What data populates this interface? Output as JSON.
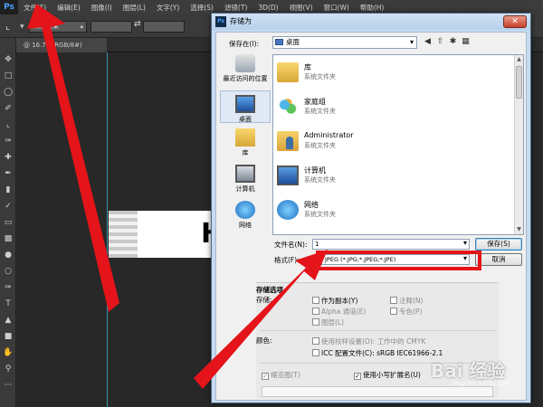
{
  "ps": {
    "logo": "Ps",
    "menu": [
      "文件(F)",
      "编辑(E)",
      "图像(I)",
      "图层(L)",
      "文字(Y)",
      "选择(S)",
      "滤镜(T)",
      "3D(D)",
      "视图(V)",
      "窗口(W)",
      "帮助(H)"
    ],
    "ratio_select": "比例约束",
    "tab_label": "@ 16.7%(RGB/8#)",
    "doc_letter": "H"
  },
  "dialog": {
    "title": "存储为",
    "save_in_label": "保存在(I):",
    "save_in_value": "桌面",
    "places": [
      {
        "label": "最近访问的位置",
        "icon": "recent-places-icon"
      },
      {
        "label": "桌面",
        "icon": "desktop-icon"
      },
      {
        "label": "库",
        "icon": "library-icon"
      },
      {
        "label": "计算机",
        "icon": "computer-icon"
      },
      {
        "label": "网络",
        "icon": "network-icon"
      }
    ],
    "files": [
      {
        "name": "库",
        "desc": "系统文件夹"
      },
      {
        "name": "家庭组",
        "desc": "系统文件夹"
      },
      {
        "name": "Administrator",
        "desc": "系统文件夹"
      },
      {
        "name": "计算机",
        "desc": "系统文件夹"
      },
      {
        "name": "网络",
        "desc": "系统文件夹"
      }
    ],
    "filename_label": "文件名(N):",
    "filename_value": "1",
    "format_label": "格式(F):",
    "format_value": "JPEG (*.JPG;*.JPEG;*.JPE)",
    "save_button": "保存(S)",
    "cancel_button": "取消",
    "options_heading": "存储选项",
    "save_label": "存储:",
    "opt_copy": "作为副本(Y)",
    "opt_alpha": "Alpha 通道(E)",
    "opt_layers": "图层(L)",
    "opt_notes": "注释(N)",
    "opt_spot": "专色(P)",
    "color_label": "颜色:",
    "opt_proof": "使用校样设置(O):",
    "opt_proof_value": "工作中的 CMYK",
    "opt_icc": "ICC 配置文件(C):",
    "opt_icc_value": "sRGB IEC61966-2.1",
    "opt_thumbnail": "缩览图(T)",
    "opt_lowercase": "使用小写扩展名(U)"
  },
  "watermark": {
    "brand": "Bai 经验",
    "url": "jingyan.baidu.com"
  },
  "colors": {
    "annotation_red": "#e4141a",
    "dialog_frame": "#c6daf0",
    "ps_dark": "#282828"
  }
}
